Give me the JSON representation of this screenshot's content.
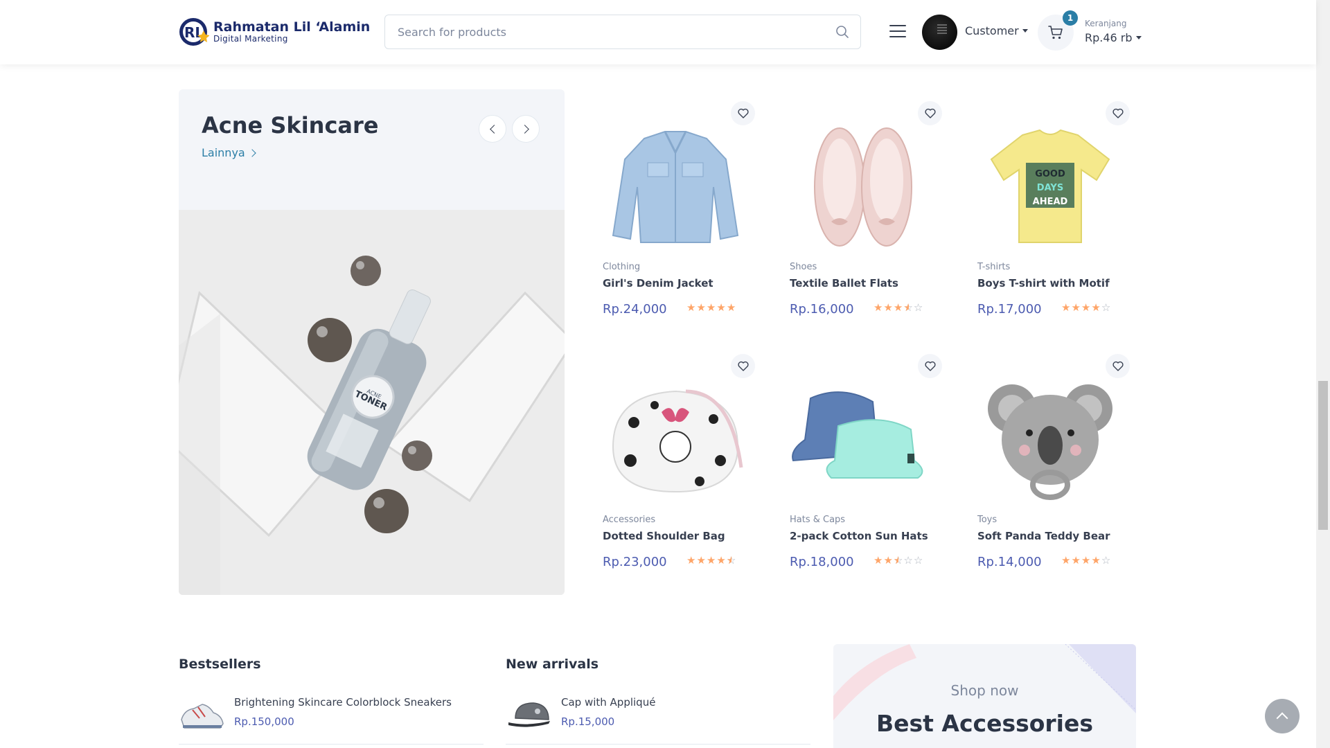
{
  "header": {
    "logo_title": "Rahmatan Lil ‘Alamin",
    "logo_subtitle": "Digital Marketing",
    "search_placeholder": "Search for products",
    "account_label": "Customer",
    "cart_count": "1",
    "cart_label": "Keranjang",
    "cart_total": "Rp.46 rb"
  },
  "promo": {
    "title": "Acne Skincare",
    "link_label": "Lainnya",
    "image_text": "ACNE TONER"
  },
  "products": [
    {
      "category": "Clothing",
      "name": "Girl's Denim Jacket",
      "price": "Rp.24,000",
      "rating": 5,
      "image": "denim-jacket"
    },
    {
      "category": "Shoes",
      "name": "Textile Ballet Flats",
      "price": "Rp.16,000",
      "rating": 3.5,
      "image": "ballet-flats"
    },
    {
      "category": "T-shirts",
      "name": "Boys T-shirt with Motif",
      "price": "Rp.17,000",
      "rating": 4,
      "image": "t-shirt"
    },
    {
      "category": "Accessories",
      "name": "Dotted Shoulder Bag",
      "price": "Rp.23,000",
      "rating": 4.5,
      "image": "shoulder-bag"
    },
    {
      "category": "Hats & Caps",
      "name": "2-pack Cotton Sun Hats",
      "price": "Rp.18,000",
      "rating": 2.5,
      "image": "sun-hats"
    },
    {
      "category": "Toys",
      "name": "Soft Panda Teddy Bear",
      "price": "Rp.14,000",
      "rating": 4,
      "image": "teddy-bear"
    }
  ],
  "bestsellers": {
    "title": "Bestsellers",
    "items": [
      {
        "name": "Brightening Skincare Colorblock Sneakers",
        "price": "Rp.150,000"
      }
    ]
  },
  "new_arrivals": {
    "title": "New arrivals",
    "items": [
      {
        "name": "Cap with Appliqué",
        "price": "Rp.15,000"
      }
    ]
  },
  "banner": {
    "subtitle": "Shop now",
    "title": "Best Accessories"
  },
  "colors": {
    "accent": "#2b7ea6",
    "price": "#4c5bb0",
    "star": "#fea569"
  }
}
